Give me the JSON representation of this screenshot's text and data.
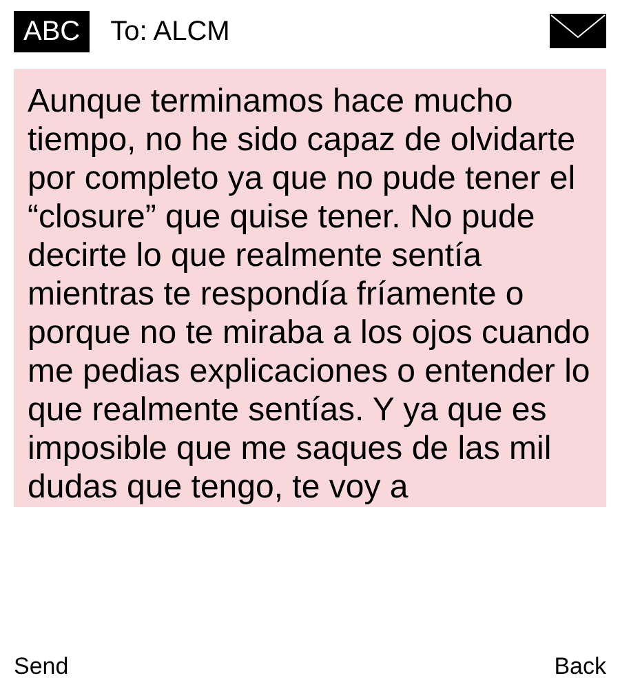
{
  "header": {
    "mode": "ABC",
    "recipient": "To: ALCM"
  },
  "message": "Aunque terminamos hace mucho tiempo, no he sido capaz de olvidarte por completo ya que no pude tener el “closure” que quise tener. No pude decirte lo que realmente sentía mientras te respondía fríamente o porque no te miraba a los ojos cuando me pedias explicaciones o entender lo que realmente sentías. Y ya que es imposible que me saques de las mil dudas que tengo, te voy a",
  "softkeys": {
    "left": "Send",
    "right": "Back"
  }
}
